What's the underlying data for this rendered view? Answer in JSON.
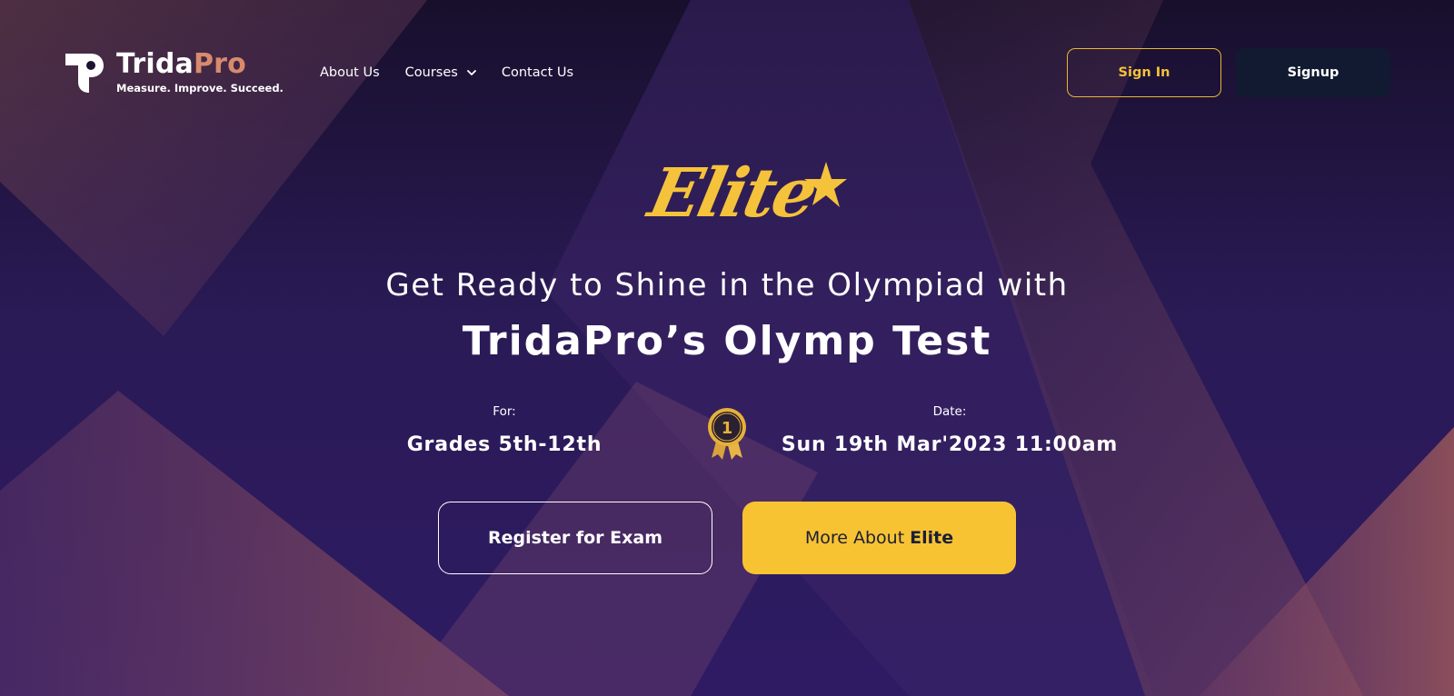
{
  "header": {
    "logo": {
      "name_part1": "Trida",
      "name_part2": "Pro",
      "tagline": "Measure. Improve. Succeed."
    },
    "nav": [
      {
        "label": "About Us"
      },
      {
        "label": "Courses",
        "has_dropdown": true
      },
      {
        "label": "Contact Us"
      }
    ],
    "signin_label": "Sign In",
    "signup_label": "Signup"
  },
  "hero": {
    "brand_word": "Elite",
    "headline": "Get Ready to Shine in the Olympiad with",
    "headline_strong": "TridaPro’s  Olymp Test",
    "for_label": "For:",
    "for_value": "Grades 5th-12th",
    "date_label": "Date:",
    "date_value": "Sun 19th Mar'2023 11:00am",
    "medal_text": "1"
  },
  "actions": {
    "register_label": "Register for Exam",
    "more_label_prefix": "More About",
    "more_label_strong": "Elite"
  },
  "colors": {
    "accent_yellow": "#f8c332",
    "brand_orange": "#d98a6e",
    "dark_button": "#111a30",
    "background": "#24164a"
  }
}
